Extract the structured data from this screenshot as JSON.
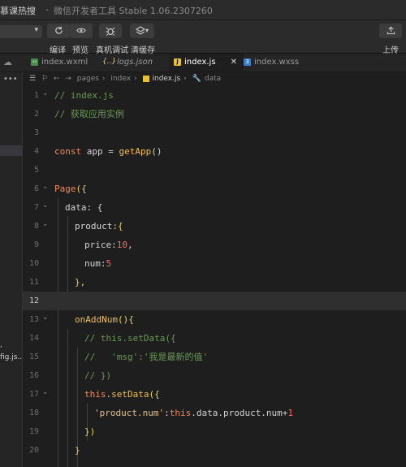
{
  "titlebar": {
    "left_text": "慕课热搜",
    "separator": "-",
    "app_title": "微信开发者工具 Stable 1.06.2307260"
  },
  "toolbar": {
    "compile_label": "编译",
    "preview_label": "预览",
    "debug_label": "真机调试",
    "cache_label": "清缓存",
    "upload_label": "上传"
  },
  "tabs": [
    {
      "name": "index.wxml",
      "icon": "wxml-file-icon"
    },
    {
      "name": "logs.json",
      "icon": "json-file-icon"
    },
    {
      "name": "index.js",
      "icon": "js-file-icon",
      "active": true
    },
    {
      "name": "index.wxss",
      "icon": "wxss-file-icon"
    }
  ],
  "breadcrumb": {
    "parts": [
      "pages",
      "index",
      "index.js",
      "data"
    ]
  },
  "sidebar": {
    "truncated_items": [
      ",",
      "fig.js..."
    ]
  },
  "editor": {
    "current_line": 12,
    "line_numbers": [
      "1",
      "2",
      "3",
      "4",
      "5",
      "6",
      "7",
      "8",
      "9",
      "10",
      "11",
      "12",
      "13",
      "14",
      "15",
      "16",
      "17",
      "18",
      "19",
      "20"
    ],
    "lines": {
      "l1": "// index.js",
      "l2": "// 获取应用实例",
      "l4_kw": "const",
      "l4_var": " app = ",
      "l4_fn": "getApp",
      "l4_end": "()",
      "l6_fn": "Page",
      "l6_br": "({",
      "l7_key": "data",
      "l7_rest": ": {",
      "l8_key": "product",
      "l8_rest": ":{",
      "l9_key": "price",
      "l9_colon": ":",
      "l9_num": "10",
      "l9_comma": ",",
      "l10_key": "num",
      "l10_colon": ":",
      "l10_num": "5",
      "l11": "},",
      "l13_fn": "onAddNum",
      "l13_rest": "(){",
      "l14": "// this.setData({",
      "l15": "//   'msg':'我是最新的值'",
      "l16": "// })",
      "l17_this": "this",
      "l17_dot": ".",
      "l17_fn": "setData",
      "l17_rest": "({",
      "l18_str": "'product.num'",
      "l18_colon": ":",
      "l18_this": "this",
      "l18_path": ".data.product.num+",
      "l18_num": "1",
      "l19": "})",
      "l20": "}"
    }
  },
  "colors": {
    "background": "#1e1e1e",
    "comment": "#6a9955",
    "keyword": "#f08a5d",
    "function": "#f0c050",
    "number": "#ff6a6a",
    "string": "#e2c08d"
  }
}
